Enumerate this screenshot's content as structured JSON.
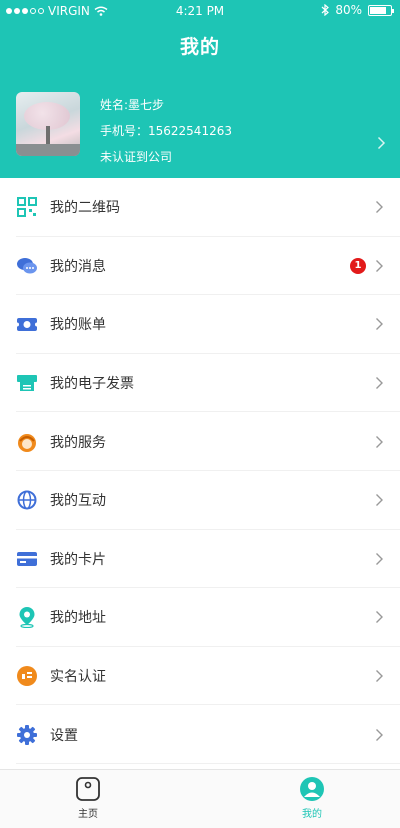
{
  "status_bar": {
    "carrier": "VIRGIN",
    "time": "4:21 PM",
    "battery": "80%",
    "battery_level": 0.8
  },
  "header": {
    "title": "我的"
  },
  "profile": {
    "name": "姓名:墨七步",
    "phone": "手机号：15622541263",
    "company": "未认证到公司"
  },
  "menu": [
    {
      "label": "我的二维码",
      "icon": "qr-code-icon"
    },
    {
      "label": "我的消息",
      "icon": "message-icon",
      "badge": "1"
    },
    {
      "label": "我的账单",
      "icon": "bill-icon"
    },
    {
      "label": "我的电子发票",
      "icon": "invoice-icon"
    },
    {
      "label": "我的服务",
      "icon": "service-icon"
    },
    {
      "label": "我的互动",
      "icon": "globe-icon"
    },
    {
      "label": "我的卡片",
      "icon": "card-icon"
    },
    {
      "label": "我的地址",
      "icon": "location-icon"
    },
    {
      "label": "实名认证",
      "icon": "verify-icon"
    },
    {
      "label": "设置",
      "icon": "gear-icon"
    }
  ],
  "tabbar": {
    "home_label": "主页",
    "mine_label": "我的",
    "active": "mine"
  },
  "colors": {
    "accent": "#1ec5b5",
    "badge": "#e21a1a",
    "text": "#333333"
  }
}
